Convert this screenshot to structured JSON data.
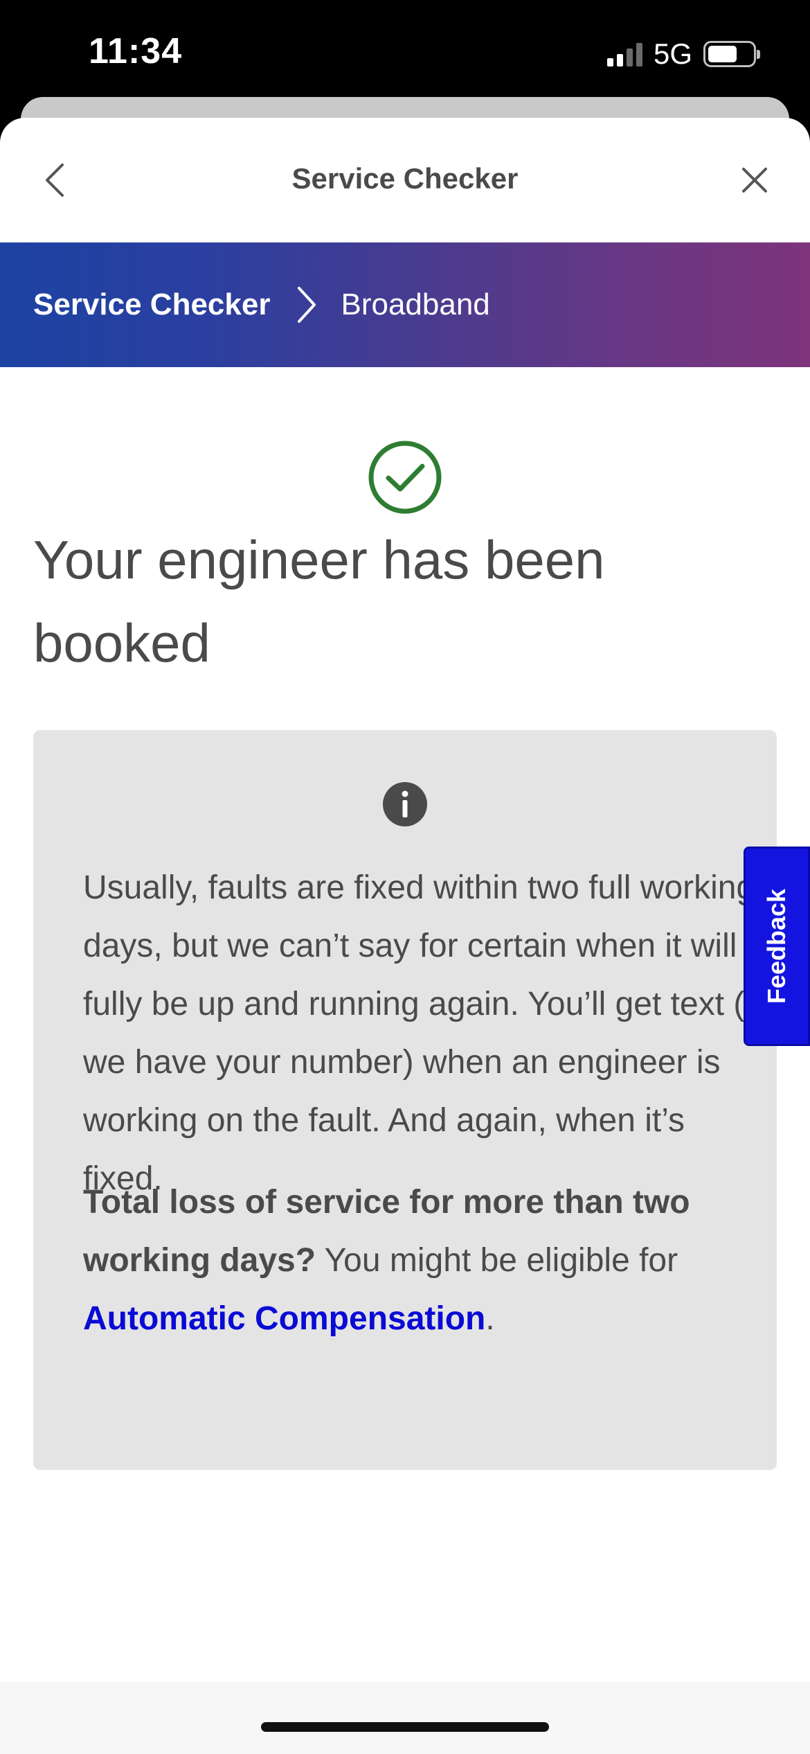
{
  "status_bar": {
    "time": "11:34",
    "network": "5G",
    "signal_bars_active": 2,
    "signal_bars_total": 4,
    "battery_level": 0.66
  },
  "nav": {
    "title": "Service Checker",
    "back_icon": "chevron-left-icon",
    "close_icon": "close-icon"
  },
  "breadcrumb": {
    "current": "Service Checker",
    "separator_icon": "chevron-right-icon",
    "child": "Broadband"
  },
  "main": {
    "status_icon": "check-circle-icon",
    "status_color": "#2e7d32",
    "headline": "Your engineer has been booked",
    "info_card": {
      "icon": "info-icon",
      "body": "Usually, faults are fixed within two full working days, but we can’t say for certain when it will fully be up and running again. You’ll get text (if we have your number) when an engineer is working on the fault. And again, when it’s fixed.",
      "compensation_bold": "Total loss of service for more than two working days?",
      "compensation_text": " You might be eligible for ",
      "compensation_link": "Automatic Compensation",
      "compensation_end": "."
    }
  },
  "feedback": {
    "label": "Feedback",
    "color": "#1414e0"
  },
  "colors": {
    "gradient_start": "#1d43a3",
    "gradient_end": "#7d347b",
    "link": "#0a0ad6"
  }
}
